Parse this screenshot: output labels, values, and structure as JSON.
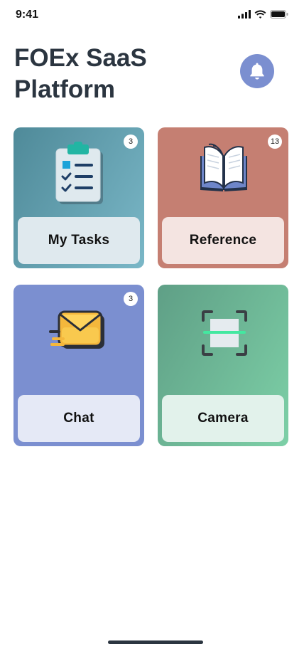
{
  "status": {
    "time": "9:41"
  },
  "header": {
    "title": "FOEx SaaS Platform"
  },
  "cards": [
    {
      "label": "My Tasks",
      "badge": "3",
      "icon": "clipboard-checklist-icon"
    },
    {
      "label": "Reference",
      "badge": "13",
      "icon": "open-book-icon"
    },
    {
      "label": "Chat",
      "badge": "3",
      "icon": "envelope-icon"
    },
    {
      "label": "Camera",
      "badge": "",
      "icon": "scan-frame-icon"
    }
  ],
  "colors": {
    "title": "#2b3540",
    "bell": "#7b8fd0",
    "tasks": "#5f9bab",
    "reference": "#c57f72",
    "chat": "#7b8fd0",
    "camera": "#6fb597"
  }
}
